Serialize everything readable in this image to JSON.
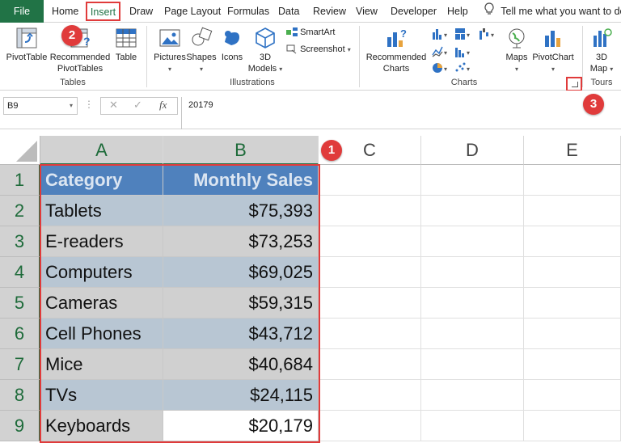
{
  "tabs": [
    "File",
    "Home",
    "Insert",
    "Draw",
    "Page Layout",
    "Formulas",
    "Data",
    "Review",
    "View",
    "Developer",
    "Help"
  ],
  "tell_me": "Tell me what you want to do",
  "ribbon": {
    "tables": {
      "label": "Tables",
      "pivot_table": "PivotTable",
      "recommended_pivot": [
        "Recommended",
        "PivotTables"
      ],
      "table": "Table"
    },
    "illustrations": {
      "label": "Illustrations",
      "pictures": "Pictures",
      "shapes": "Shapes",
      "icons": "Icons",
      "models": [
        "3D",
        "Models"
      ],
      "smartart": "SmartArt",
      "screenshot": "Screenshot"
    },
    "charts": {
      "label": "Charts",
      "recommended": [
        "Recommended",
        "Charts"
      ],
      "maps": "Maps",
      "pivot_chart": "PivotChart"
    },
    "tours": {
      "label": "Tours",
      "map3d": [
        "3D",
        "Map"
      ]
    }
  },
  "formula_bar": {
    "name_box": "B9",
    "value": "20179"
  },
  "columns": [
    "A",
    "B",
    "C",
    "D",
    "E"
  ],
  "rows": [
    "1",
    "2",
    "3",
    "4",
    "5",
    "6",
    "7",
    "8",
    "9"
  ],
  "table": {
    "headers": [
      "Category",
      "Monthly Sales"
    ],
    "data": [
      [
        "Tablets",
        "$75,393"
      ],
      [
        "E-readers",
        "$73,253"
      ],
      [
        "Computers",
        "$69,025"
      ],
      [
        "Cameras",
        "$59,315"
      ],
      [
        "Cell Phones",
        "$43,712"
      ],
      [
        "Mice",
        "$40,684"
      ],
      [
        "TVs",
        "$24,115"
      ],
      [
        "Keyboards",
        "$20,179"
      ]
    ]
  },
  "callouts": [
    "1",
    "2",
    "3"
  ],
  "colors": {
    "excel_green": "#217346",
    "highlight_red": "#e03b3b",
    "header_blue": "#4f81bd"
  }
}
